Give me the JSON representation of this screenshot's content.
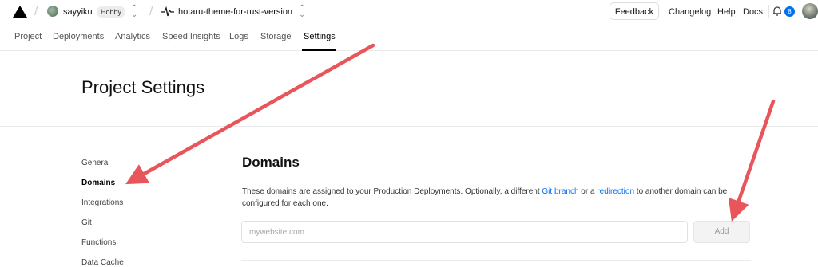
{
  "header": {
    "team_name": "sayyiku",
    "plan_badge": "Hobby",
    "project_name": "hotaru-theme-for-rust-version",
    "feedback_label": "Feedback",
    "links": [
      "Changelog",
      "Help",
      "Docs"
    ],
    "notification_count": "8"
  },
  "tabs": [
    "Project",
    "Deployments",
    "Analytics",
    "Speed Insights",
    "Logs",
    "Storage",
    "Settings"
  ],
  "active_tab": "Settings",
  "page_title": "Project Settings",
  "sidebar": {
    "items": [
      "General",
      "Domains",
      "Integrations",
      "Git",
      "Functions",
      "Data Cache"
    ],
    "active": "Domains"
  },
  "domains": {
    "title": "Domains",
    "description_part1": "These domains are assigned to your Production Deployments. Optionally, a different ",
    "link_git_branch": "Git branch",
    "description_part2": " or a ",
    "link_redirection": "redirection",
    "description_part3": " to another domain can be configured for each one.",
    "input_placeholder": "mywebsite.com",
    "input_value": "",
    "add_label": "Add"
  },
  "annotation_color": "#e8555b"
}
